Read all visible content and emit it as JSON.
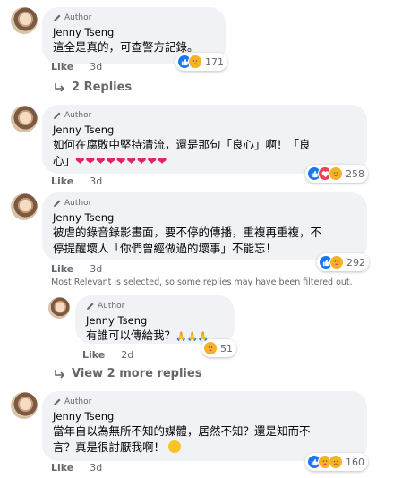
{
  "comments": [
    {
      "badge": "Author",
      "name": "Jenny Tseng",
      "text": "這全是真的，可查警方記錄。",
      "reaction_count": "171",
      "reactions": [
        "like",
        "care"
      ],
      "like_label": "Like",
      "time": "3d"
    },
    {
      "badge": "Author",
      "name": "Jenny Tseng",
      "text_line1": "如何在腐敗中堅持清流，還是那句「良心」啊！「良",
      "text_line2": "心」",
      "hearts": "❤❤❤❤❤❤❤❤❤",
      "reaction_count": "258",
      "reactions": [
        "like",
        "love",
        "care"
      ],
      "like_label": "Like",
      "time": "3d"
    },
    {
      "badge": "Author",
      "name": "Jenny Tseng",
      "text_line1": "被虐的錄音錄影畫面，要不停的傳播，重複再重複，不",
      "text_line2": "停提醒壞人「你們曾經做過的壞事」不能忘！",
      "reaction_count": "292",
      "reactions": [
        "like",
        "care"
      ],
      "like_label": "Like",
      "time": "3d"
    },
    {
      "badge": "Author",
      "name": "Jenny Tseng",
      "text": "有誰可以傳給我？",
      "emoji_tail": "🙏🙏🙏",
      "reaction_count": "51",
      "reactions": [
        "care"
      ],
      "like_label": "Like",
      "time": "2d"
    },
    {
      "badge": "Author",
      "name": "Jenny Tseng",
      "text_line1": "當年自以為無所不知的媒體，居然不知？還是知而不",
      "text_line2": "言？真是很討厭我啊！",
      "reaction_count": "160",
      "reactions": [
        "like",
        "care",
        "sad"
      ],
      "like_label": "Like",
      "time": "3d"
    }
  ],
  "replies_link_1": "2 Replies",
  "notice": "Most Relevant is selected, so some replies may have been filtered out.",
  "replies_link_2": "View 2 more replies",
  "colors": {
    "bubble": "#f0f2f5",
    "secondary_text": "#65676b",
    "like_blue": "#1877f2",
    "love_red": "#f33e58",
    "care_yellow": "#f7b125"
  }
}
